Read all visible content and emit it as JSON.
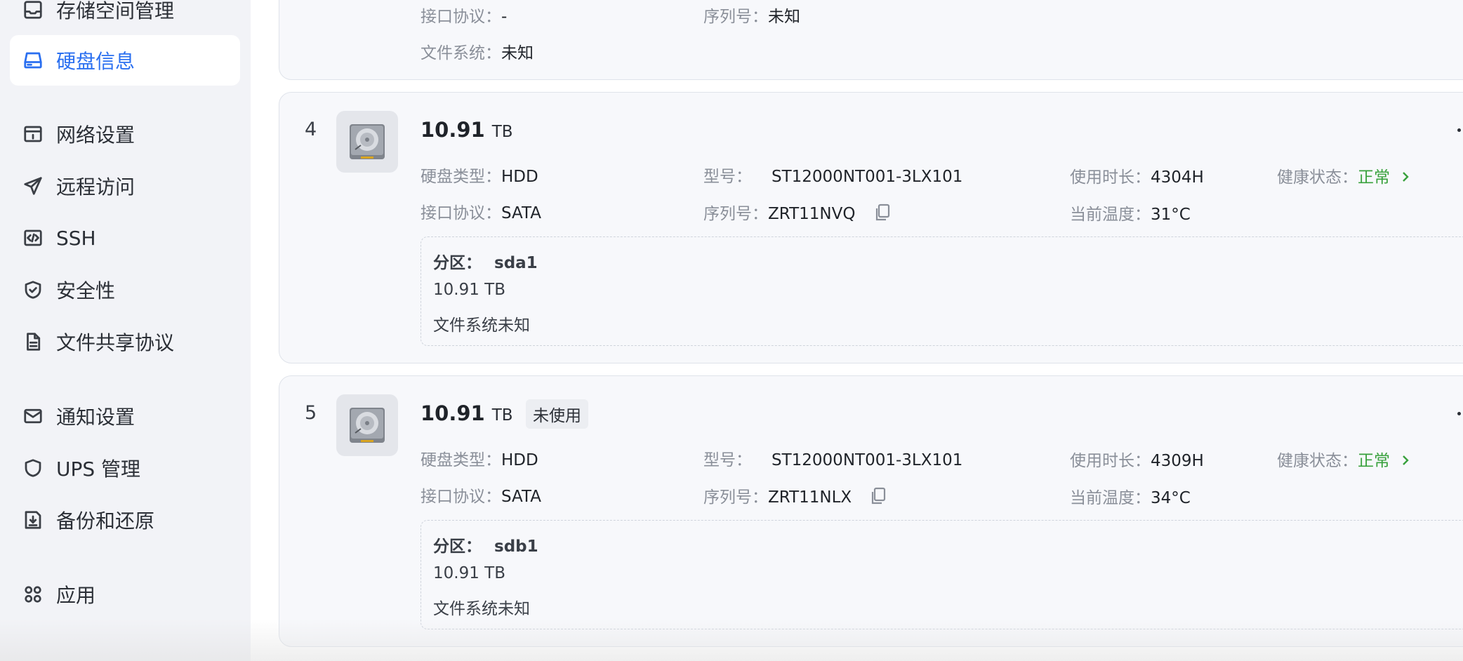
{
  "sidebar": {
    "items": [
      {
        "label": "存储空间管理",
        "icon": "storage-icon"
      },
      {
        "label": "硬盘信息",
        "icon": "disk-icon",
        "active": true
      },
      {
        "label": "网络设置",
        "icon": "network-icon"
      },
      {
        "label": "远程访问",
        "icon": "send-icon"
      },
      {
        "label": "SSH",
        "icon": "code-icon"
      },
      {
        "label": "安全性",
        "icon": "shield-check-icon"
      },
      {
        "label": "文件共享协议",
        "icon": "document-icon"
      },
      {
        "label": "通知设置",
        "icon": "mail-icon"
      },
      {
        "label": "UPS 管理",
        "icon": "shield-icon"
      },
      {
        "label": "备份和还原",
        "icon": "backup-icon"
      },
      {
        "label": "应用",
        "icon": "apps-icon"
      }
    ]
  },
  "prev_card": {
    "interface_label": "接口协议：",
    "interface_value": "-",
    "serial_label": "序列号：",
    "serial_value": "未知",
    "fs_label": "文件系统：",
    "fs_value": "未知"
  },
  "disks": [
    {
      "index": "4",
      "capacity": "10.91",
      "unit": "TB",
      "type_label": "硬盘类型：",
      "type_value": "HDD",
      "model_label": "型号：",
      "model_value": "ST12000NT001-3LX101",
      "usage_label": "使用时长：",
      "usage_value": "4304H",
      "health_label": "健康状态：",
      "health_value": "正常",
      "interface_label": "接口协议：",
      "interface_value": "SATA",
      "serial_label": "序列号：",
      "serial_value": "ZRT11NVQ",
      "temp_label": "当前温度：",
      "temp_value": "31°C",
      "partition": {
        "label": "分区：",
        "name": "sda1",
        "size": "10.91 TB",
        "fs": "文件系统未知"
      }
    },
    {
      "index": "5",
      "capacity": "10.91",
      "unit": "TB",
      "badge": "未使用",
      "type_label": "硬盘类型：",
      "type_value": "HDD",
      "model_label": "型号：",
      "model_value": "ST12000NT001-3LX101",
      "usage_label": "使用时长：",
      "usage_value": "4309H",
      "health_label": "健康状态：",
      "health_value": "正常",
      "interface_label": "接口协议：",
      "interface_value": "SATA",
      "serial_label": "序列号：",
      "serial_value": "ZRT11NLX",
      "temp_label": "当前温度：",
      "temp_value": "34°C",
      "partition": {
        "label": "分区：",
        "name": "sdb1",
        "size": "10.91 TB",
        "fs": "文件系统未知"
      }
    }
  ],
  "colors": {
    "accent": "#2a6ff0",
    "healthy": "#38a13c",
    "sidebar_bg": "#f2f3f7"
  }
}
